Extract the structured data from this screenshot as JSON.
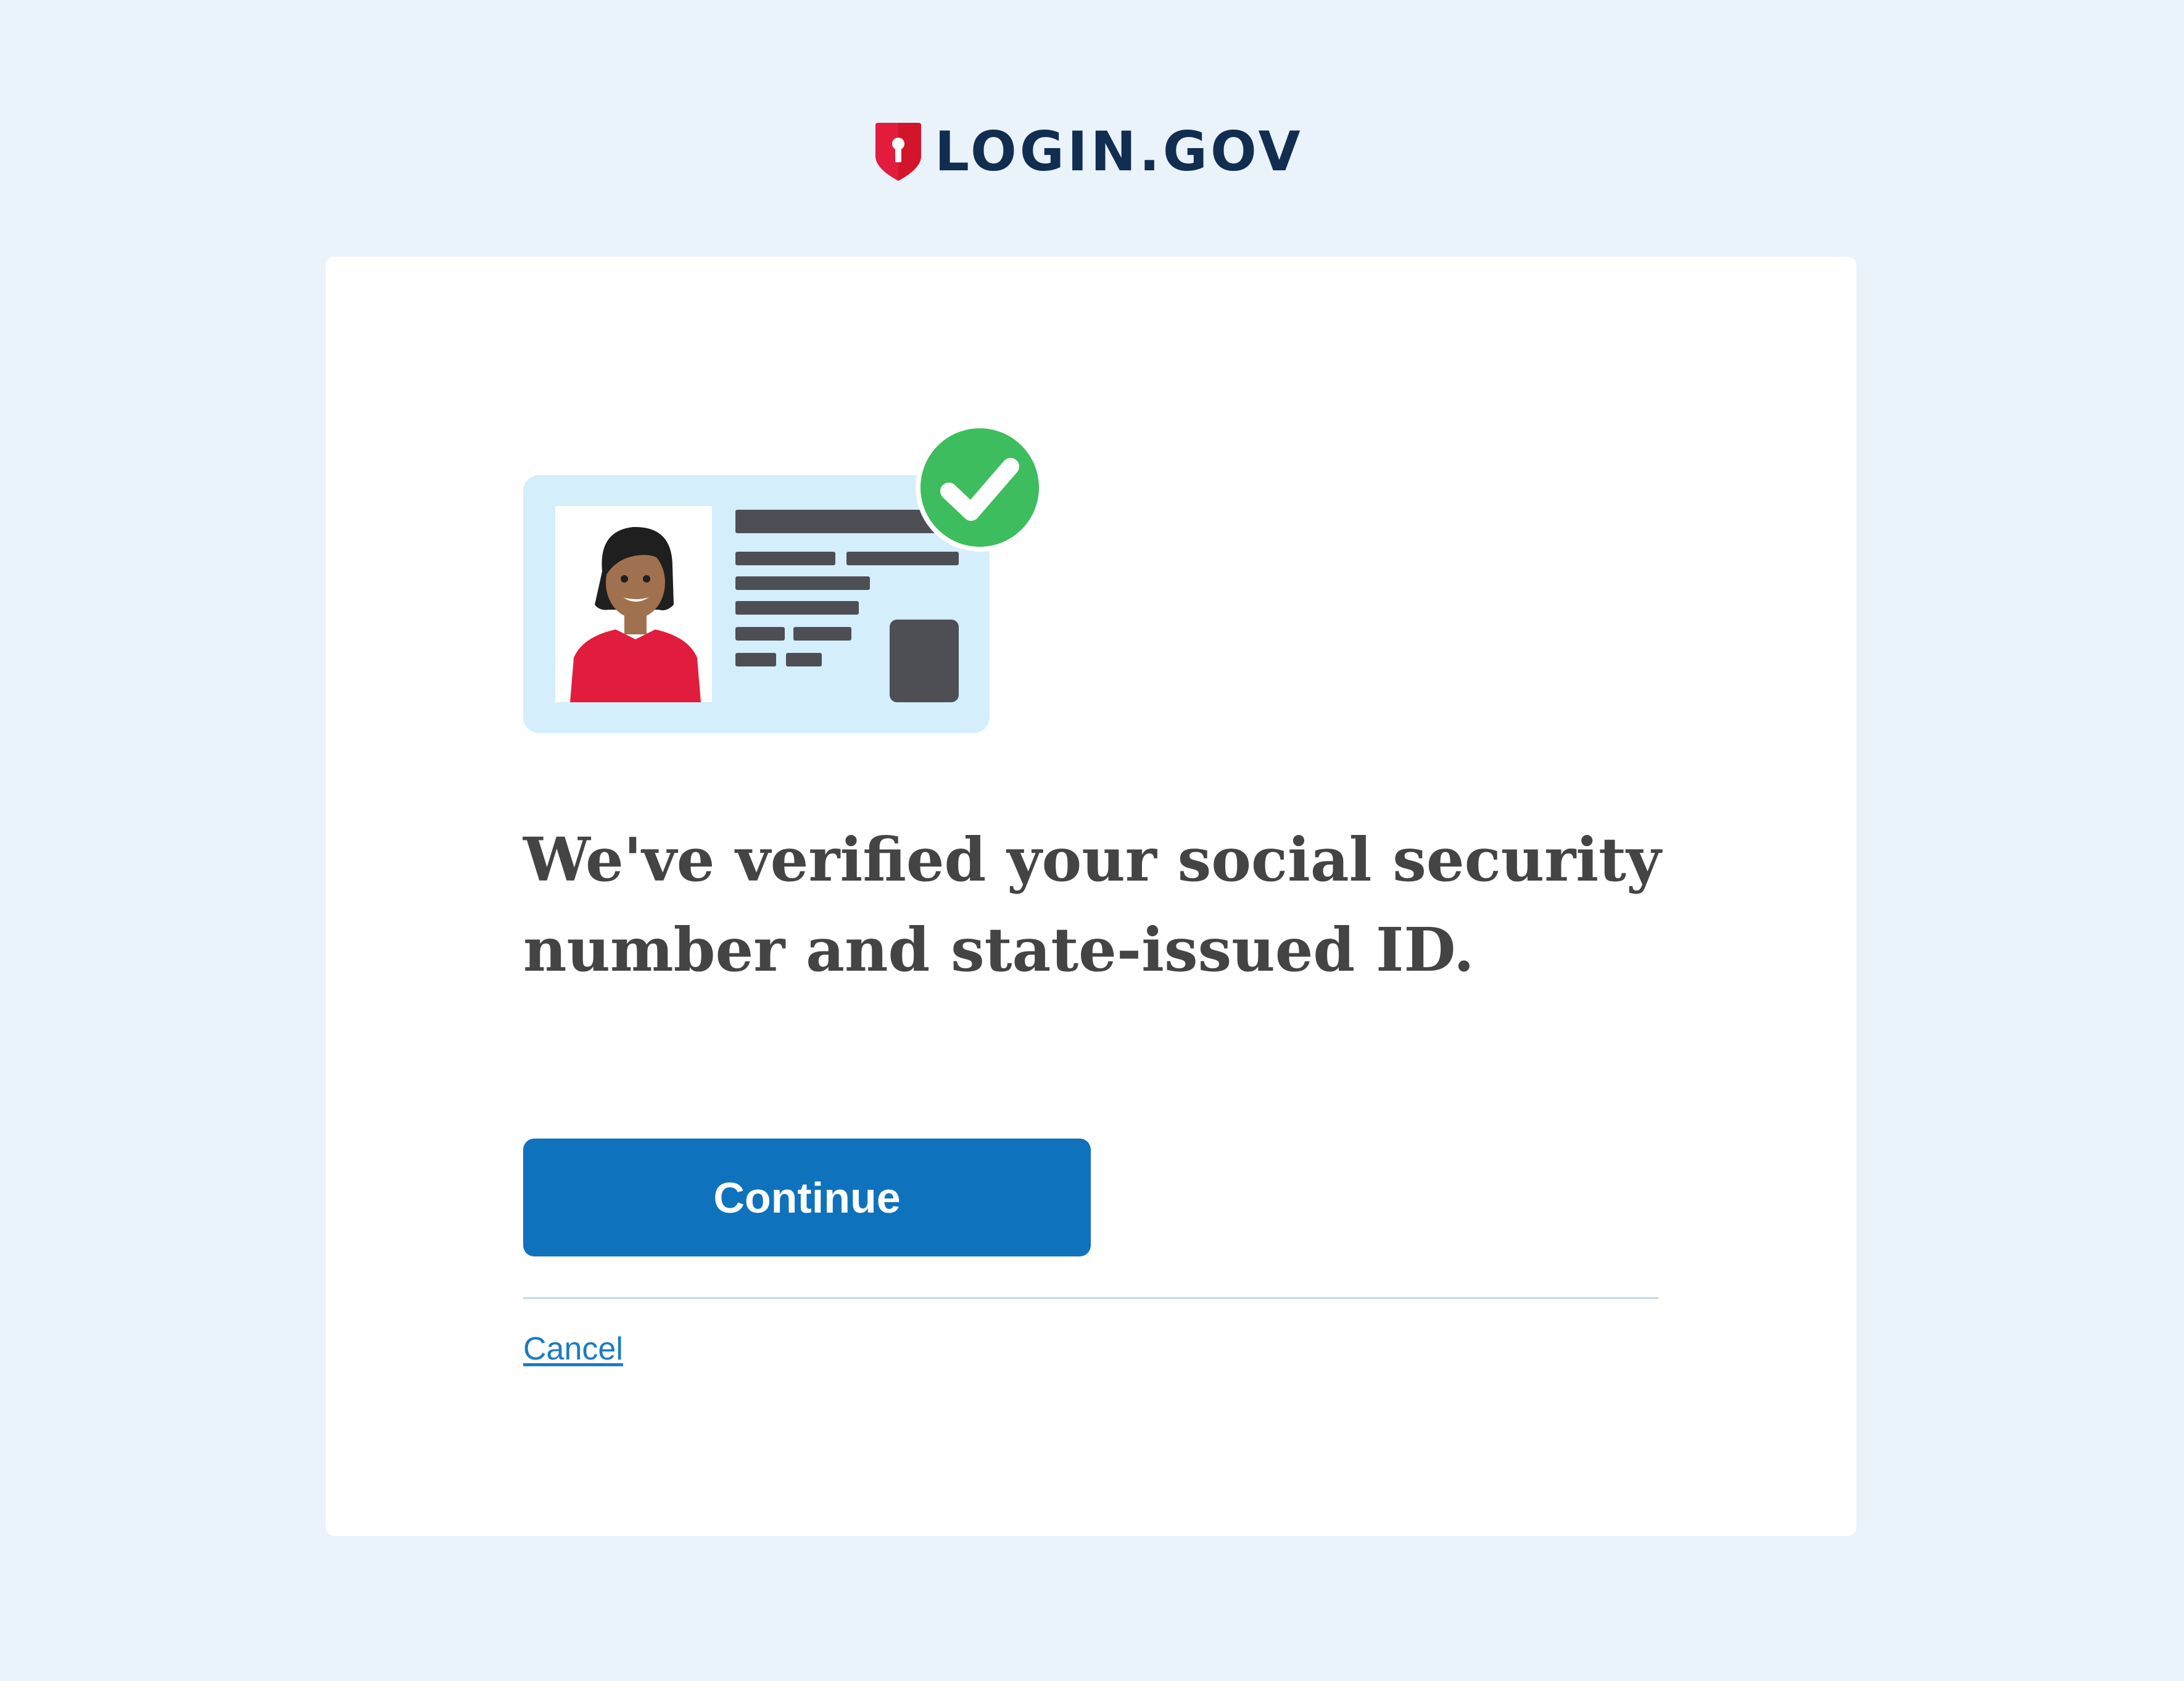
{
  "header": {
    "brand_name": "LOGIN.GOV",
    "logo_icon": "shield-keyhole-icon"
  },
  "main": {
    "illustration_icons": [
      "id-card-icon",
      "check-circle-icon"
    ],
    "heading": "We've verified your social security number and state-issued ID.",
    "continue_label": "Continue",
    "cancel_label": "Cancel"
  },
  "colors": {
    "page_background": "#eaf2fa",
    "brand_navy": "#112e51",
    "brand_red": "#e21c3d",
    "primary_button": "#0e72bc",
    "link": "#1a7bc4",
    "success_green": "#3dbd5d"
  }
}
